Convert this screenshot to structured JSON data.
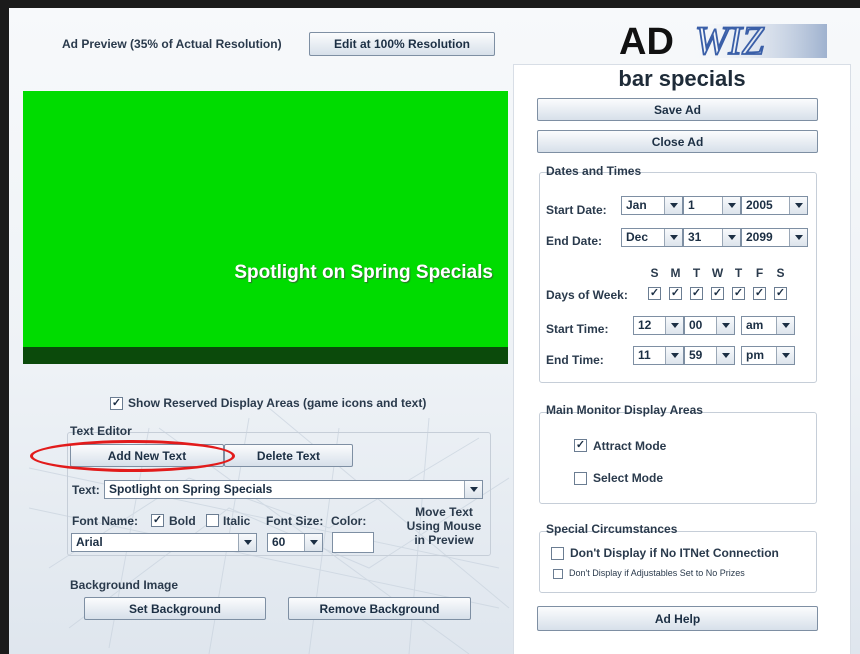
{
  "preview_header": {
    "label": "Ad Preview (35% of Actual Resolution)",
    "edit_button": "Edit at 100% Resolution"
  },
  "preview": {
    "text": "Spotlight on Spring Specials",
    "background_color": "#00dc00"
  },
  "logo": {
    "text_ad": "AD",
    "text_wiz": "WIZ"
  },
  "ad_title": "bar specials",
  "actions": {
    "save": "Save Ad",
    "close": "Close Ad",
    "help": "Ad Help"
  },
  "dates_times": {
    "legend": "Dates and Times",
    "start_date": {
      "label": "Start Date:",
      "month": "Jan",
      "day": "1",
      "year": "2005"
    },
    "end_date": {
      "label": "End Date:",
      "month": "Dec",
      "day": "31",
      "year": "2099"
    },
    "days_label": "Days of Week:",
    "days": [
      {
        "letter": "S",
        "checked": true
      },
      {
        "letter": "M",
        "checked": true
      },
      {
        "letter": "T",
        "checked": true
      },
      {
        "letter": "W",
        "checked": true
      },
      {
        "letter": "T",
        "checked": true
      },
      {
        "letter": "F",
        "checked": true
      },
      {
        "letter": "S",
        "checked": true
      }
    ],
    "start_time": {
      "label": "Start Time:",
      "hour": "12",
      "minute": "00",
      "ampm": "am"
    },
    "end_time": {
      "label": "End Time:",
      "hour": "11",
      "minute": "59",
      "ampm": "pm"
    }
  },
  "monitor": {
    "legend": "Main Monitor Display Areas",
    "attract": {
      "label": "Attract Mode",
      "checked": true
    },
    "select": {
      "label": "Select Mode",
      "checked": false
    }
  },
  "special": {
    "legend": "Special Circumstances",
    "no_itnet": {
      "label": "Don't Display if No ITNet Connection",
      "checked": false
    },
    "no_prizes": {
      "label": "Don't Display if Adjustables Set to No Prizes",
      "checked": false
    }
  },
  "reserved": {
    "label": "Show Reserved Display Areas (game icons and text)",
    "checked": true
  },
  "text_editor": {
    "legend": "Text Editor",
    "add_button": "Add New Text",
    "delete_button": "Delete Text",
    "text_label": "Text:",
    "text_value": "Spotlight on Spring Specials",
    "font_name_label": "Font Name:",
    "bold_label": "Bold",
    "bold_checked": true,
    "italic_label": "Italic",
    "italic_checked": false,
    "font_size_label": "Font Size:",
    "color_label": "Color:",
    "font_value": "Arial",
    "size_value": "60",
    "move_hint": [
      "Move Text",
      "Using Mouse",
      "in Preview"
    ]
  },
  "background_image": {
    "label": "Background Image",
    "set_button": "Set Background",
    "remove_button": "Remove Background"
  },
  "colors": {
    "accent_red": "#e21b1b",
    "logo_black": "#111111",
    "logo_blue": "#3a5fa8"
  }
}
